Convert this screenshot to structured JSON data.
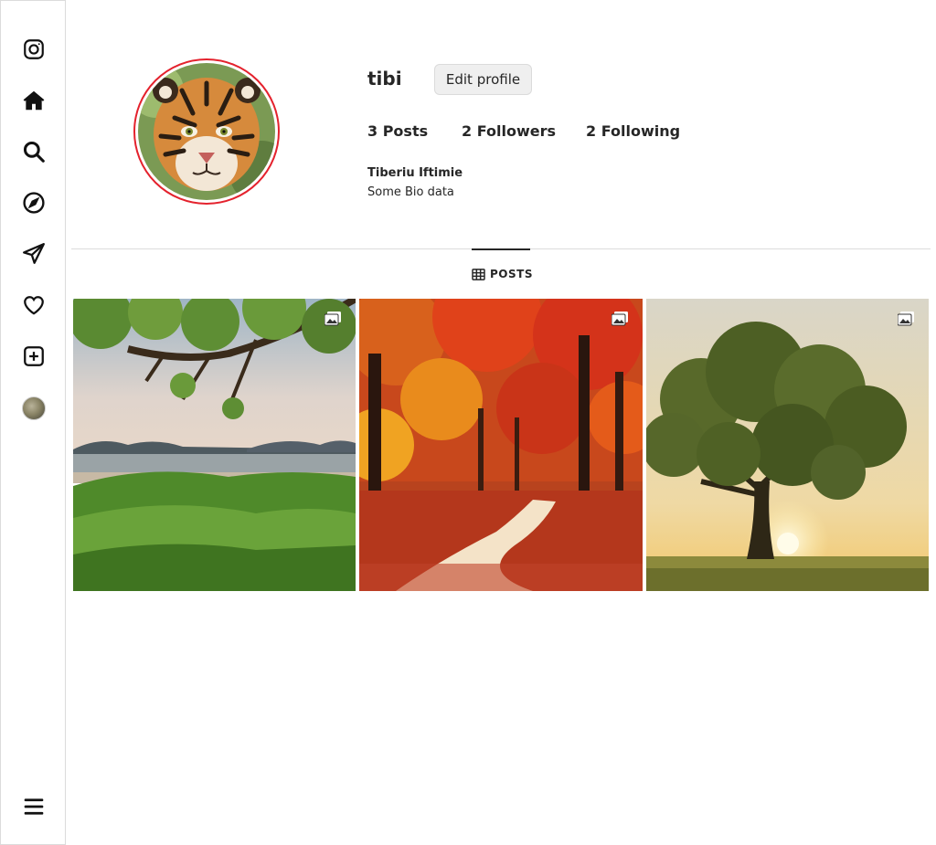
{
  "sidebar": {
    "items": [
      {
        "name": "instagram-logo-icon"
      },
      {
        "name": "home-icon"
      },
      {
        "name": "search-icon"
      },
      {
        "name": "explore-compass-icon"
      },
      {
        "name": "messages-send-icon"
      },
      {
        "name": "notifications-heart-icon"
      },
      {
        "name": "create-post-icon"
      },
      {
        "name": "profile-avatar"
      },
      {
        "name": "more-menu-icon"
      }
    ]
  },
  "profile": {
    "username": "tibi",
    "edit_label": "Edit profile",
    "posts_stat": "3 Posts",
    "followers_stat": "2 Followers",
    "following_stat": "2 Following",
    "full_name": "Tiberiu Iftimie",
    "bio": "Some Bio data",
    "ring_color": "#e4222d"
  },
  "tabs": {
    "posts_label": "POSTS"
  },
  "posts": [
    {
      "scene": "tropical-beach-with-tree",
      "multi_icon": "gallery-icon"
    },
    {
      "scene": "autumn-forest-path",
      "multi_icon": "gallery-icon"
    },
    {
      "scene": "lone-tree-at-sunset",
      "multi_icon": "gallery-icon"
    }
  ]
}
